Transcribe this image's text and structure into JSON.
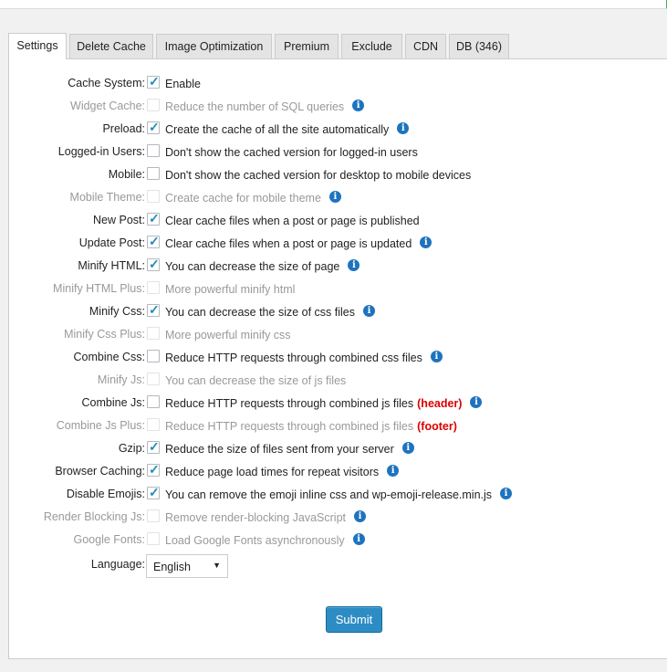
{
  "tabs": [
    {
      "label": "Settings",
      "active": true
    },
    {
      "label": "Delete Cache"
    },
    {
      "label": "Image Optimization"
    },
    {
      "label": "Premium"
    },
    {
      "label": "Exclude"
    },
    {
      "label": "CDN"
    },
    {
      "label": "DB (346)"
    }
  ],
  "settings": [
    {
      "label": "Cache System:",
      "desc": "Enable",
      "checked": true,
      "disabled": false,
      "info": false
    },
    {
      "label": "Widget Cache:",
      "desc": "Reduce the number of SQL queries",
      "checked": false,
      "disabled": true,
      "info": true
    },
    {
      "label": "Preload:",
      "desc": "Create the cache of all the site automatically",
      "checked": true,
      "disabled": false,
      "info": true
    },
    {
      "label": "Logged-in Users:",
      "desc": "Don't show the cached version for logged-in users",
      "checked": false,
      "disabled": false,
      "info": false
    },
    {
      "label": "Mobile:",
      "desc": "Don't show the cached version for desktop to mobile devices",
      "checked": false,
      "disabled": false,
      "info": false
    },
    {
      "label": "Mobile Theme:",
      "desc": "Create cache for mobile theme",
      "checked": false,
      "disabled": true,
      "info": true
    },
    {
      "label": "New Post:",
      "desc": "Clear cache files when a post or page is published",
      "checked": true,
      "disabled": false,
      "info": false
    },
    {
      "label": "Update Post:",
      "desc": "Clear cache files when a post or page is updated",
      "checked": true,
      "disabled": false,
      "info": true
    },
    {
      "label": "Minify HTML:",
      "desc": "You can decrease the size of page",
      "checked": true,
      "disabled": false,
      "info": true
    },
    {
      "label": "Minify HTML Plus:",
      "desc": "More powerful minify html",
      "checked": false,
      "disabled": true,
      "info": false
    },
    {
      "label": "Minify Css:",
      "desc": "You can decrease the size of css files",
      "checked": true,
      "disabled": false,
      "info": true
    },
    {
      "label": "Minify Css Plus:",
      "desc": "More powerful minify css",
      "checked": false,
      "disabled": true,
      "info": false
    },
    {
      "label": "Combine Css:",
      "desc": "Reduce HTTP requests through combined css files",
      "checked": false,
      "disabled": false,
      "info": true
    },
    {
      "label": "Minify Js:",
      "desc": "You can decrease the size of js files",
      "checked": false,
      "disabled": true,
      "info": false
    },
    {
      "label": "Combine Js:",
      "desc": "Reduce HTTP requests through combined js files",
      "tag": "(header)",
      "checked": false,
      "disabled": false,
      "info": true
    },
    {
      "label": "Combine Js Plus:",
      "desc": "Reduce HTTP requests through combined js files",
      "tag": "(footer)",
      "checked": false,
      "disabled": true,
      "info": false
    },
    {
      "label": "Gzip:",
      "desc": "Reduce the size of files sent from your server",
      "checked": true,
      "disabled": false,
      "info": true
    },
    {
      "label": "Browser Caching:",
      "desc": "Reduce page load times for repeat visitors",
      "checked": true,
      "disabled": false,
      "info": true
    },
    {
      "label": "Disable Emojis:",
      "desc": "You can remove the emoji inline css and wp-emoji-release.min.js",
      "checked": true,
      "disabled": false,
      "info": true
    },
    {
      "label": "Render Blocking Js:",
      "desc": "Remove render-blocking JavaScript",
      "checked": false,
      "disabled": true,
      "info": true
    },
    {
      "label": "Google Fonts:",
      "desc": "Load Google Fonts asynchronously",
      "checked": false,
      "disabled": true,
      "info": true
    }
  ],
  "language": {
    "label": "Language:",
    "value": "English"
  },
  "submit_label": "Submit",
  "icons": {
    "info": "info-icon",
    "check": "checkmark-icon",
    "dropdown": "dropdown-arrow-icon"
  },
  "colors": {
    "accent": "#1e73be",
    "button": "#2e8cc4",
    "tag": "#dd0000",
    "disabled_text": "#999999"
  }
}
